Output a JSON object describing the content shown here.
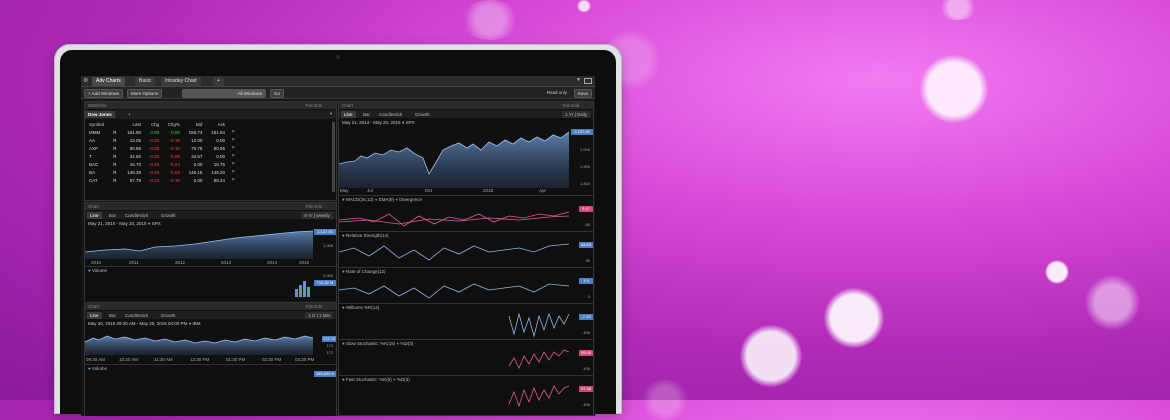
{
  "tabs": {
    "adv": "Adv Charts",
    "basic": "Basic",
    "intraday": "Intraday Chart",
    "add": "+"
  },
  "toolbar": {
    "add_windows": "+ Add Windows",
    "more_options": "More Options",
    "all_windows": "All Windows",
    "go": "Go",
    "read_only": "Read only",
    "save": "Save"
  },
  "watchlist": {
    "head": "Watchlist",
    "head_right": "File Edit",
    "name": "Dow Jones",
    "add": "+",
    "columns": [
      "Symbol",
      "",
      "Last",
      "Chg",
      "Chg%",
      "Bid",
      "Ask"
    ],
    "rows": [
      {
        "sym": "MMM",
        "r": "R",
        "last": "161.90",
        "chg": "0.00",
        "pct": "0.00",
        "bid": "156.74",
        "ask": "161.84",
        "dir": "up"
      },
      {
        "sym": "AA",
        "r": "R",
        "last": "13.05",
        "chg": "-0.02",
        "pct": "-0.15",
        "bid": "12.00",
        "ask": "0.00",
        "dir": "dn"
      },
      {
        "sym": "AXP",
        "r": "R",
        "last": "80.88",
        "chg": "-0.08",
        "pct": "-0.10",
        "bid": "79.78",
        "ask": "80.95",
        "dir": "dn"
      },
      {
        "sym": "T",
        "r": "R",
        "last": "34.60",
        "chg": "-0.02",
        "pct": "-0.06",
        "bid": "34.57",
        "ask": "0.00",
        "dir": "dn"
      },
      {
        "sym": "BAC",
        "r": "R",
        "last": "16.70",
        "chg": "-0.04",
        "pct": "-0.24",
        "bid": "0.00",
        "ask": "16.75",
        "dir": "dn"
      },
      {
        "sym": "BA",
        "r": "R",
        "last": "146.38",
        "chg": "-0.04",
        "pct": "-0.03",
        "bid": "146.16",
        "ask": "149.20",
        "dir": "dn"
      },
      {
        "sym": "CAT",
        "r": "R",
        "last": "87.79",
        "chg": "-0.14",
        "pct": "-0.16",
        "bid": "0.00",
        "ask": "88.24",
        "dir": "dn"
      }
    ]
  },
  "chart_spx5": {
    "head": "Chart",
    "head_right": "File Edit",
    "tabs": [
      "Line",
      "Bar",
      "Candlestick",
      "Growth"
    ],
    "period": "5 Yr | weekly",
    "range": "May 21, 2010 - May 20, 2015",
    "symbol": "SPX",
    "last": "2,127.83",
    "ylabel": "1,000",
    "xticks": [
      "2010",
      "2011",
      "2012",
      "2013",
      "2014",
      "2015"
    ],
    "volume": "Volume",
    "vol_label": "2,000",
    "vol_last": "712.52 M"
  },
  "chart_ibm": {
    "head": "Chart",
    "head_right": "File Edit",
    "tabs": [
      "Line",
      "Bar",
      "Candlestick",
      "Growth"
    ],
    "period": "1 D | 1 Min",
    "range": "May 20, 2015 09:30 AM - May 20, 2015 04:00 PM",
    "symbol": "IBM",
    "last": "172.70",
    "y1": "173",
    "y2": "172",
    "xticks": [
      "09:30 AM",
      "10:30 AM",
      "11:30 AM",
      "12:30 PM",
      "01:30 PM",
      "02:30 PM",
      "03:30 PM"
    ],
    "volume": "Volume",
    "vol_last": "185,832 K"
  },
  "chart_spx1": {
    "head": "Chart",
    "head_right": "File Edit",
    "tabs": [
      "Line",
      "Bar",
      "Candlestick",
      "Growth"
    ],
    "period": "1 Yr | Daily",
    "range": "May 21, 2014 - May 20, 2015",
    "symbol": "SPX",
    "last": "2,127.83",
    "yticks": [
      "2,000",
      "1,900",
      "1,800"
    ],
    "xticks": [
      "May",
      "Jul",
      "Oct",
      "2015",
      "Apr"
    ]
  },
  "indicators": [
    {
      "title": "MACD(26,12)",
      "extra1": "EMA(9)",
      "extra2": "Divergence",
      "tag": "5.47",
      "tagcolor": "#d0457c",
      "low": "-50"
    },
    {
      "title": "Relative Strength(14)",
      "tag": "68.63",
      "tagcolor": "#4b7fc4",
      "low": "50"
    },
    {
      "title": "Rate of Change(12)",
      "tag": "1.9",
      "tagcolor": "#4b7fc4",
      "low": "0"
    },
    {
      "title": "Williams %R(14)",
      "tag": "-7.20",
      "tagcolor": "#4b7fc4",
      "low": "-100"
    },
    {
      "title": "Slow Stochastic: %K(15)",
      "extra1": "%D(3)",
      "tag": "95.05",
      "tagcolor": "#d0457c",
      "low": "-100"
    },
    {
      "title": "Fast Stochastic: %K(5)",
      "extra1": "%D(3)",
      "tag": "97.96",
      "tagcolor": "#d0457c",
      "low": "-100"
    }
  ]
}
